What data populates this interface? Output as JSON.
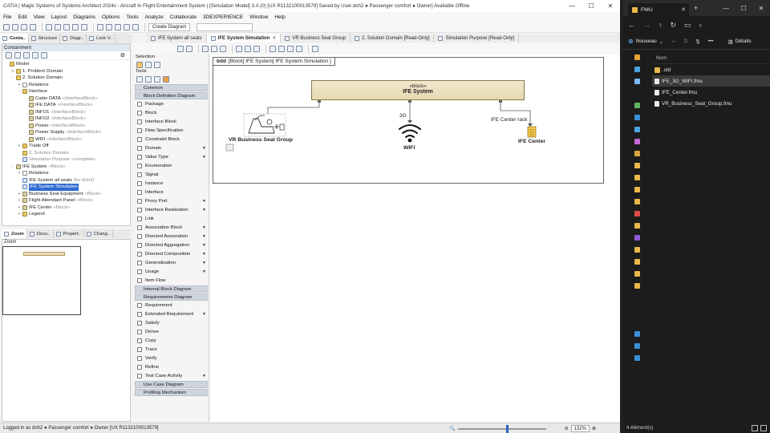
{
  "catia": {
    "title": "CATIA | Magic Systems of Systems Architect 2024x - Aircraft In Flight Entertainment System | [Simulation Model] 3.A (0) [UX R1132100013579] Saved by User.doh2 ● Passenger comfort ● Owner] Available Offline",
    "menu": [
      "File",
      "Edit",
      "View",
      "Layout",
      "Diagrams",
      "Options",
      "Tools",
      "Analyze",
      "Collaborate",
      "3DEXPERIENCE",
      "Window",
      "Help"
    ],
    "create_diagram_label": "Create Diagram",
    "left_tabs": [
      "Conta..",
      "Structure",
      "Diagr..",
      "Lock V.."
    ],
    "containment_title": "Containment",
    "tree": [
      {
        "indent": 0,
        "exp": "",
        "icon": "pkg",
        "label": "Model",
        "stereo": ""
      },
      {
        "indent": 1,
        "exp": "+",
        "icon": "pkg",
        "label": "1. Problem Domain",
        "stereo": ""
      },
      {
        "indent": 1,
        "exp": "-",
        "icon": "pkg",
        "label": "2. Solution Domain",
        "stereo": ""
      },
      {
        "indent": 2,
        "exp": "+",
        "icon": "rel",
        "label": "Relations",
        "stereo": ""
      },
      {
        "indent": 2,
        "exp": "-",
        "icon": "pkg",
        "label": "Interface",
        "stereo": ""
      },
      {
        "indent": 3,
        "exp": "",
        "icon": "blk",
        "label": "Cabin DATA",
        "stereo": "«InterfaceBlock»"
      },
      {
        "indent": 3,
        "exp": "",
        "icon": "blk",
        "label": "IFE DATA",
        "stereo": "«InterfaceBlock»"
      },
      {
        "indent": 3,
        "exp": "",
        "icon": "blk",
        "label": "INFO1",
        "stereo": "«InterfaceBlock»"
      },
      {
        "indent": 3,
        "exp": "",
        "icon": "blk",
        "label": "INFO2",
        "stereo": "«InterfaceBlock»"
      },
      {
        "indent": 3,
        "exp": "",
        "icon": "blk",
        "label": "Power",
        "stereo": "«InterfaceBlock»"
      },
      {
        "indent": 3,
        "exp": "",
        "icon": "blk",
        "label": "Power Supply",
        "stereo": "«InterfaceBlock»"
      },
      {
        "indent": 3,
        "exp": "",
        "icon": "blk",
        "label": "WIFI",
        "stereo": "«InterfaceBlock»"
      },
      {
        "indent": 2,
        "exp": "+",
        "icon": "pkg",
        "label": "Trade Off",
        "stereo": ""
      },
      {
        "indent": 2,
        "exp": "",
        "icon": "pkg",
        "label": "2. Solution Domain",
        "stereo": "",
        "grey": true
      },
      {
        "indent": 2,
        "exp": "",
        "icon": "dia",
        "label": "Simulation Purpose",
        "stereo": "«complete»",
        "grey": true
      },
      {
        "indent": 1,
        "exp": "-",
        "icon": "blk",
        "label": "IFE System",
        "stereo": "«Block»"
      },
      {
        "indent": 2,
        "exp": "+",
        "icon": "rel",
        "label": "Relations",
        "stereo": ""
      },
      {
        "indent": 2,
        "exp": "",
        "icon": "dia",
        "label": "IFE System all seats",
        "stereo": "(fer doh2)"
      },
      {
        "indent": 2,
        "exp": "",
        "icon": "dia",
        "label": "IFE System Simulation",
        "stereo": "",
        "selected": true
      },
      {
        "indent": 2,
        "exp": "+",
        "icon": "blk",
        "label": "Business Seat Equipment",
        "stereo": "«Block»"
      },
      {
        "indent": 2,
        "exp": "+",
        "icon": "blk",
        "label": "Flight Attendant Panel",
        "stereo": "«Block»"
      },
      {
        "indent": 2,
        "exp": "+",
        "icon": "blk",
        "label": "IFE Center",
        "stereo": "«Block»"
      },
      {
        "indent": 2,
        "exp": "+",
        "icon": "pkg",
        "label": "Legend",
        "stereo": ""
      }
    ],
    "bottom_tabs": [
      "Zoom",
      "Docu..",
      "Propert..",
      "Chang.."
    ],
    "zoom_title": "Zoom",
    "palette": {
      "selection_label": "Selection",
      "tools_label": "Tools",
      "items": [
        {
          "kind": "group",
          "label": "Common"
        },
        {
          "kind": "group",
          "label": "Block Definition Diagram"
        },
        {
          "kind": "item",
          "label": "Package",
          "arrow": false
        },
        {
          "kind": "item",
          "label": "Block",
          "arrow": false
        },
        {
          "kind": "item",
          "label": "Interface Block",
          "arrow": false
        },
        {
          "kind": "item",
          "label": "Flow Specification",
          "arrow": false
        },
        {
          "kind": "item",
          "label": "Constraint Block",
          "arrow": false
        },
        {
          "kind": "item",
          "label": "Domain",
          "arrow": true
        },
        {
          "kind": "item",
          "label": "Value Type",
          "arrow": true
        },
        {
          "kind": "item",
          "label": "Enumeration",
          "arrow": false
        },
        {
          "kind": "item",
          "label": "Signal",
          "arrow": false
        },
        {
          "kind": "item",
          "label": "Instance",
          "arrow": false
        },
        {
          "kind": "item",
          "label": "Interface",
          "arrow": false
        },
        {
          "kind": "item",
          "label": "Proxy Port",
          "arrow": true
        },
        {
          "kind": "item",
          "label": "Interface Realization",
          "arrow": true
        },
        {
          "kind": "item",
          "label": "Link",
          "arrow": false
        },
        {
          "kind": "item",
          "label": "Association Block",
          "arrow": true
        },
        {
          "kind": "item",
          "label": "Directed Association",
          "arrow": true
        },
        {
          "kind": "item",
          "label": "Directed Aggregation",
          "arrow": true
        },
        {
          "kind": "item",
          "label": "Directed Composition",
          "arrow": true
        },
        {
          "kind": "item",
          "label": "Generalization",
          "arrow": true
        },
        {
          "kind": "item",
          "label": "Usage",
          "arrow": true
        },
        {
          "kind": "item",
          "label": "Item Flow",
          "arrow": false
        },
        {
          "kind": "group",
          "label": "Internal Block Diagram"
        },
        {
          "kind": "group",
          "label": "Requirements Diagram"
        },
        {
          "kind": "item",
          "label": "Requirement",
          "arrow": false
        },
        {
          "kind": "item",
          "label": "Extended Requirement",
          "arrow": true
        },
        {
          "kind": "item",
          "label": "Satisfy",
          "arrow": false
        },
        {
          "kind": "item",
          "label": "Derive",
          "arrow": false
        },
        {
          "kind": "item",
          "label": "Copy",
          "arrow": false
        },
        {
          "kind": "item",
          "label": "Trace",
          "arrow": false
        },
        {
          "kind": "item",
          "label": "Verify",
          "arrow": false
        },
        {
          "kind": "item",
          "label": "Refine",
          "arrow": false
        },
        {
          "kind": "item",
          "label": "Test Case Activity",
          "arrow": true
        },
        {
          "kind": "group",
          "label": "Use Case Diagram"
        },
        {
          "kind": "group",
          "label": "Profiling Mechanism"
        }
      ]
    },
    "diagram_tabs": [
      {
        "label": "IFE System all seats",
        "active": false
      },
      {
        "label": "IFE System Simulation",
        "active": true
      },
      {
        "label": "VR Business Seat Group",
        "active": false
      },
      {
        "label": "2. Solution Domain [Read-Only]",
        "active": false
      },
      {
        "label": "Simulation Purpose [Read-Only]",
        "active": false
      }
    ],
    "diagram": {
      "frame_kind": "bdd",
      "frame_text": "[Block] IFE System[ IFE System Simulation ]",
      "block_stereotype": "«block»",
      "block_name": "IFE System",
      "part_seat": "VR Business Seat Group",
      "part_wifi": "WIFI",
      "part_center": "IFE Center",
      "conn_3g": "3G",
      "conn_rack": "IFE Center rack"
    },
    "status_text": "Logged in as doh2 ● Passenger comfort ● Owner [UX R1132100013579]",
    "zoom_level": "132%"
  },
  "explorer": {
    "tab_title": "FMU",
    "new_label": "Nouveau",
    "details_label": "Détails",
    "column_name": "Nom",
    "files": [
      {
        "name": ".old",
        "type": "folder",
        "selected": false
      },
      {
        "name": "IFE_3G_WIFI.fmu",
        "type": "file",
        "selected": true
      },
      {
        "name": "IFE_Center.fmu",
        "type": "file",
        "selected": false
      },
      {
        "name": "VR_Business_Seat_Group.fmu",
        "type": "file",
        "selected": false
      }
    ],
    "status": "4 élément(s)",
    "colors": {
      "folder": "#e8b84a",
      "bg": "#1c1c1c"
    }
  }
}
